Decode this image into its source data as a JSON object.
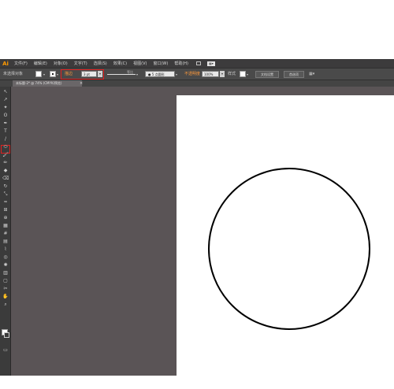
{
  "app": {
    "logo": "Ai"
  },
  "menubar": {
    "items": [
      "文件(F)",
      "编辑(E)",
      "对象(O)",
      "文字(T)",
      "选择(S)",
      "效果(C)",
      "视图(V)",
      "窗口(W)",
      "帮助(H)"
    ],
    "workspace_dropdown": "▦▾"
  },
  "controlbar": {
    "selection_status": "未选择对象",
    "stroke_label": "描边",
    "stroke_weight": "3 pt",
    "equal_label": "等比",
    "brush_value": "● 5 点圆形",
    "opacity_label": "不透明度",
    "opacity_value": "100%",
    "style_label": "样式",
    "document_setup_label": "文档设置",
    "preferences_label": "首选项",
    "dropdown_arrow": "▾"
  },
  "document_tab": {
    "label": "未标题-2* @ 74% (CMYK/预览)",
    "close": "×"
  },
  "toolbox": {
    "tools": [
      {
        "name": "selection-tool",
        "glyph": "↖"
      },
      {
        "name": "direct-selection-tool",
        "glyph": "↗"
      },
      {
        "name": "magic-wand-tool",
        "glyph": "✦"
      },
      {
        "name": "lasso-tool",
        "glyph": "ʘ"
      },
      {
        "name": "pen-tool",
        "glyph": "✒"
      },
      {
        "name": "type-tool",
        "glyph": "T"
      },
      {
        "name": "line-tool",
        "glyph": "/"
      },
      {
        "name": "ellipse-tool",
        "glyph": "⬭"
      },
      {
        "name": "paintbrush-tool",
        "glyph": "🖌"
      },
      {
        "name": "pencil-tool",
        "glyph": "✏"
      },
      {
        "name": "blob-brush-tool",
        "glyph": "◆"
      },
      {
        "name": "eraser-tool",
        "glyph": "⌫"
      },
      {
        "name": "rotate-tool",
        "glyph": "↻"
      },
      {
        "name": "scale-tool",
        "glyph": "⤡"
      },
      {
        "name": "warp-tool",
        "glyph": "≈"
      },
      {
        "name": "free-transform-tool",
        "glyph": "⊞"
      },
      {
        "name": "shape-builder-tool",
        "glyph": "⊕"
      },
      {
        "name": "perspective-grid-tool",
        "glyph": "▦"
      },
      {
        "name": "mesh-tool",
        "glyph": "#"
      },
      {
        "name": "gradient-tool",
        "glyph": "▤"
      },
      {
        "name": "eyedropper-tool",
        "glyph": "⌇"
      },
      {
        "name": "blend-tool",
        "glyph": "◎"
      },
      {
        "name": "symbol-sprayer-tool",
        "glyph": "✺"
      },
      {
        "name": "column-graph-tool",
        "glyph": "▥"
      },
      {
        "name": "artboard-tool",
        "glyph": "▢"
      },
      {
        "name": "slice-tool",
        "glyph": "✂"
      },
      {
        "name": "hand-tool",
        "glyph": "✋"
      },
      {
        "name": "zoom-tool",
        "glyph": "⌕"
      }
    ],
    "screen_mode": "▭"
  },
  "colors": {
    "accent_orange": "#ff9a3c",
    "highlight_red": "#e02020",
    "workspace_gray": "#5a5456"
  }
}
